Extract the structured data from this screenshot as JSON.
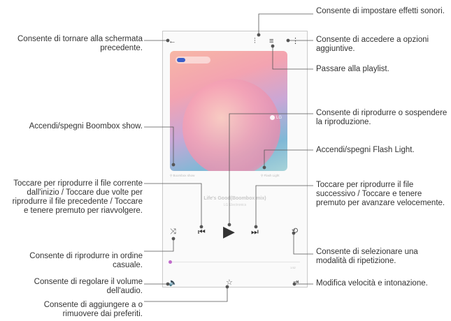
{
  "phone": {
    "song_title": "Life's Good(Boombox mix)",
    "song_artist": "LG Electronics",
    "boombox_label": "Boombox show",
    "flashlight_label": "Flash Light",
    "album_brand": "LG",
    "time_total": "1:52",
    "icons": [
      "back-arrow-icon",
      "equalizer-icon",
      "playlist-icon",
      "more-options-icon",
      "previous-icon",
      "play-icon",
      "next-icon",
      "shuffle-icon",
      "repeat-icon",
      "volume-icon",
      "favorite-star-icon",
      "speed-pitch-icon"
    ]
  },
  "callouts": {
    "back": "Consente di tornare alla schermata precedente.",
    "boombox": "Accendi/spegni Boombox show.",
    "previous": "Toccare per riprodurre il file corrente dall'inizio / Toccare due volte per riprodurre il file precedente / Toccare e tenere premuto per riavvolgere.",
    "shuffle": "Consente di riprodurre in ordine casuale.",
    "volume": "Consente di regolare il volume dell'audio.",
    "favorite": "Consente di aggiungere a o rimuovere dai preferiti.",
    "sound_effects": "Consente di impostare effetti sonori.",
    "more_options": "Consente di accedere a opzioni aggiuntive.",
    "playlist": "Passare alla playlist.",
    "play_pause": "Consente di riprodurre o sospendere la riproduzione.",
    "flashlight": "Accendi/spegni Flash Light.",
    "next": "Toccare per riprodurre il file successivo / Toccare e tenere premuto per avanzare velocemente.",
    "repeat": "Consente di selezionare una modalità di ripetizione.",
    "speed": "Modifica velocità e intonazione."
  },
  "colors": {
    "accent": "#c06acb",
    "line": "#555555"
  }
}
